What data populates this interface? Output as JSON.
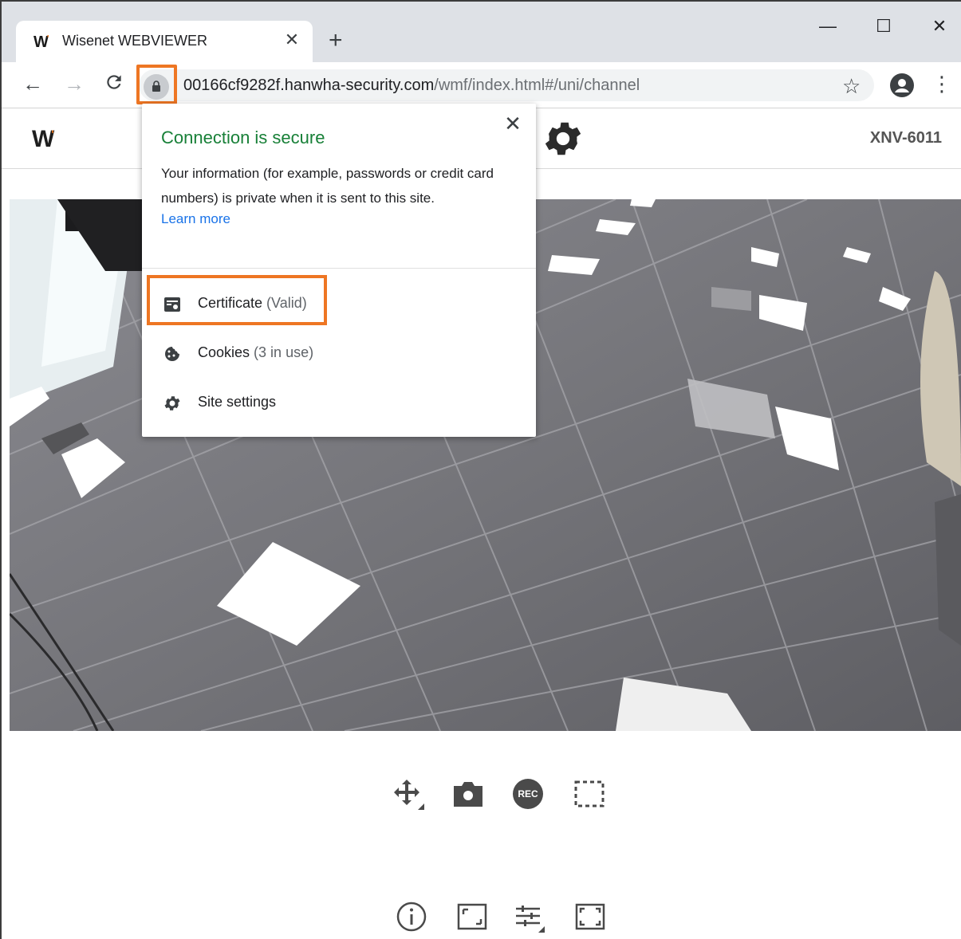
{
  "browser": {
    "tab": {
      "title": "Wisenet WEBVIEWER",
      "favicon_text": "W",
      "close_glyph": "✕"
    },
    "new_tab_glyph": "+",
    "window_controls": {
      "minimize": "—",
      "maximize": "☐",
      "close": "✕"
    },
    "nav": {
      "back": "←",
      "forward": "→",
      "reload": "C"
    },
    "address": {
      "host": "00166cf9282f.hanwha-security.com",
      "path": "/wmf/index.html#/uni/channel"
    },
    "star_glyph": "☆",
    "menu_glyph": "⋮"
  },
  "app": {
    "logo_text": "W",
    "model": "XNV-6011"
  },
  "site_info_popup": {
    "close_glyph": "✕",
    "title": "Connection is secure",
    "description": "Your information (for example, passwords or credit card numbers) is private when it is sent to this site.",
    "learn_more": "Learn more",
    "items": [
      {
        "label": "Certificate",
        "detail": "(Valid)",
        "icon": "certificate-icon"
      },
      {
        "label": "Cookies",
        "detail": "(3 in use)",
        "icon": "cookie-icon"
      },
      {
        "label": "Site settings",
        "detail": "",
        "icon": "gear-icon"
      }
    ]
  },
  "controls": {
    "row1": [
      "move-icon",
      "camera-icon",
      "record-icon",
      "select-area-icon"
    ],
    "record_label": "REC",
    "row2": [
      "info-icon",
      "aspect-ratio-icon",
      "adjust-icon",
      "fullscreen-icon"
    ]
  },
  "colors": {
    "highlight": "#ee7623",
    "secure_green": "#188038",
    "link_blue": "#1a73e8",
    "brand_orange": "#e8711a"
  }
}
